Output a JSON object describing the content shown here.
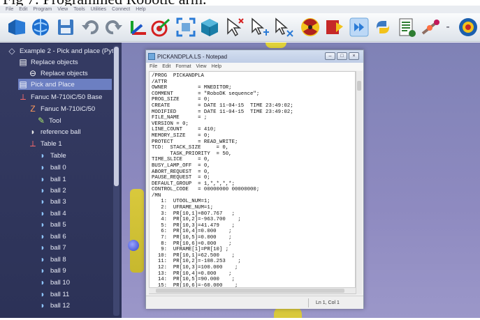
{
  "caption": "Fig 7: Programmed Robotic arm.",
  "menubar": [
    "File",
    "Edit",
    "Program",
    "View",
    "Tools",
    "Utilities",
    "Connect",
    "Help"
  ],
  "toolbar": {
    "icons": [
      "open-station-icon",
      "online-library-icon",
      "save-icon",
      "undo-icon",
      "redo-icon",
      "add-reference-frame-icon",
      "add-target-icon",
      "fit-all-icon",
      "3d-view-icon",
      "select-cursor-icon",
      "move-reference-icon",
      "move-tool-icon",
      "collision-check-icon",
      "simulation-stop-icon",
      "fast-simulation-icon",
      "python-program-icon",
      "program-file-icon",
      "move-joints-icon",
      "more-icon",
      "help-icon"
    ]
  },
  "tree": {
    "items": [
      {
        "label": "Example 2 - Pick and place (Pyt...",
        "icon": "station-icon"
      },
      {
        "label": "Replace objects",
        "icon": "script-icon"
      },
      {
        "label": "Replace objects",
        "icon": "python-icon"
      },
      {
        "label": "Pick and Place",
        "icon": "program-icon",
        "selected": true
      },
      {
        "label": "Fanuc M-710iC/50 Base",
        "icon": "frame-icon"
      },
      {
        "label": "Fanuc M-710iC/50",
        "icon": "robot-icon"
      },
      {
        "label": "Tool",
        "icon": "tool-icon"
      },
      {
        "label": "reference ball",
        "icon": "object-icon"
      },
      {
        "label": "Table 1",
        "icon": "frame-icon"
      },
      {
        "label": "Table",
        "icon": "object-icon"
      },
      {
        "label": "ball 0",
        "icon": "object-icon"
      },
      {
        "label": "ball 1",
        "icon": "object-icon"
      },
      {
        "label": "ball 2",
        "icon": "object-icon"
      },
      {
        "label": "ball 3",
        "icon": "object-icon"
      },
      {
        "label": "ball 4",
        "icon": "object-icon"
      },
      {
        "label": "ball 5",
        "icon": "object-icon"
      },
      {
        "label": "ball 6",
        "icon": "object-icon"
      },
      {
        "label": "ball 7",
        "icon": "object-icon"
      },
      {
        "label": "ball 8",
        "icon": "object-icon"
      },
      {
        "label": "ball 9",
        "icon": "object-icon"
      },
      {
        "label": "ball 10",
        "icon": "object-icon"
      },
      {
        "label": "ball 11",
        "icon": "object-icon"
      },
      {
        "label": "ball 12",
        "icon": "object-icon"
      }
    ]
  },
  "notepad": {
    "title": "PICKANDPLA.LS - Notepad",
    "menu": [
      "File",
      "Edit",
      "Format",
      "View",
      "Help"
    ],
    "lines": [
      "/PROG  PICKANDPLA",
      "/ATTR",
      "OWNER          = MNEDITOR;",
      "COMMENT        = \"RoboDK sequence\";",
      "PROG_SIZE      = 0;",
      "CREATE         = DATE 11-04-15  TIME 23:49:02;",
      "MODIFIED       = DATE 11-04-15  TIME 23:49:02;",
      "FILE_NAME      = ;",
      "VERSION = 0;",
      "LINE_COUNT     = 410;",
      "MEMORY_SIZE    = 0;",
      "PROTECT        = READ_WRITE;",
      "TCD:  STACK_SIZE     = 0,",
      "      TASK_PRIORITY  = 50,",
      "TIME_SLICE     = 0,",
      "BUSY_LAMP_OFF  = 0,",
      "ABORT_REQUEST  = 0,",
      "PAUSE_REQUEST  = 0;",
      "DEFAULT_GROUP  = 1,*,*,*,*;",
      "CONTROL_CODE   = 00000000 00000000;",
      "/MN",
      "   1:  UTOOL_NUM=1;",
      "   2:  UFRAME_NUM=1;",
      "   3:  PR[10,1]=807.767   ;",
      "   4:  PR[10,2]=-963.700    ;",
      "   5:  PR[10,3]=41.479    ;",
      "   6:  PR[10,4]=0.000    ;",
      "   7:  PR[10,5]=0.000    ;",
      "   8:  PR[10,6]=0.000    ;",
      "   9:  UFRAME[1]=PR[10] ;",
      "  10:  PR[10,1]=62.500    ;",
      "  11:  PR[10,2]=-108.253    ;",
      "  12:  PR[10,3]=100.000    ;",
      "  13:  PR[10,4]=0.000    ;",
      "  14:  PR[10,5]=90.000    ;",
      "  15:  PR[10,6]=-60.000    ;"
    ],
    "status": "Ln 1, Col 1"
  },
  "colors": {
    "tree_bg": "#2f355b",
    "tree_selected": "#6c7fc2",
    "viewport_bg": "#8e8ac0",
    "robot_yellow": "#d9c93c"
  }
}
